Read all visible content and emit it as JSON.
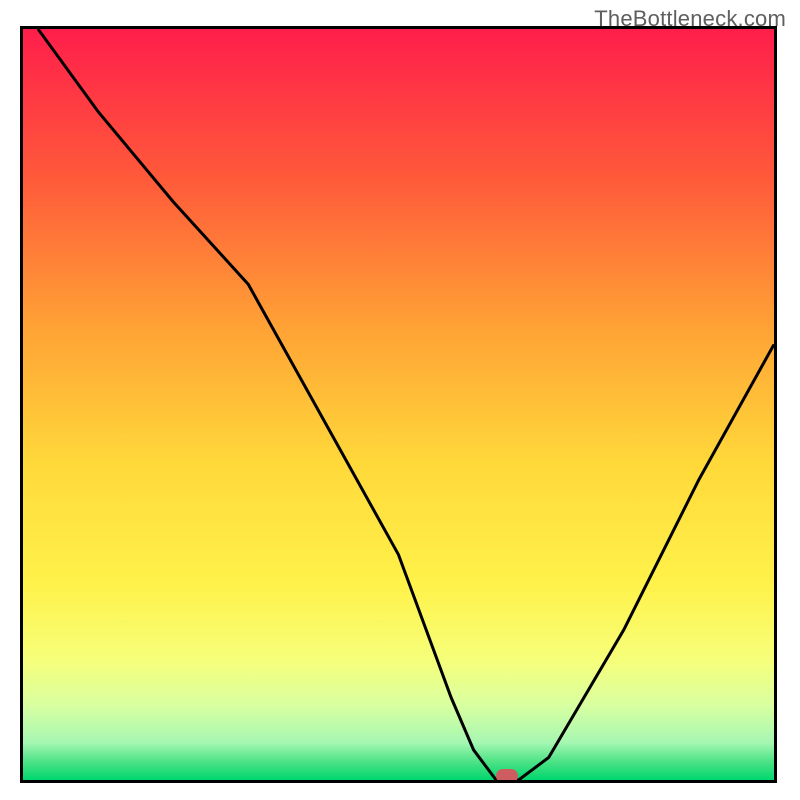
{
  "watermark": "TheBottleneck.com",
  "chart_data": {
    "type": "line",
    "title": "",
    "xlabel": "",
    "ylabel": "",
    "xlim": [
      0,
      100
    ],
    "ylim": [
      0,
      100
    ],
    "grid": false,
    "legend": false,
    "x": [
      2,
      10,
      20,
      30,
      40,
      50,
      57,
      60,
      63,
      66,
      70,
      80,
      90,
      100
    ],
    "y": [
      100,
      89,
      77,
      66,
      48,
      30,
      11,
      4,
      0,
      0,
      3,
      20,
      40,
      58
    ],
    "gradient_stops": [
      {
        "pos": 0.0,
        "color": "#ff1e4b"
      },
      {
        "pos": 0.2,
        "color": "#ff5a3a"
      },
      {
        "pos": 0.4,
        "color": "#ffa335"
      },
      {
        "pos": 0.58,
        "color": "#ffd93a"
      },
      {
        "pos": 0.74,
        "color": "#fff24a"
      },
      {
        "pos": 0.84,
        "color": "#f6ff7a"
      },
      {
        "pos": 0.9,
        "color": "#d9ffa0"
      },
      {
        "pos": 0.95,
        "color": "#a6f7b2"
      },
      {
        "pos": 0.975,
        "color": "#4fe387"
      },
      {
        "pos": 1.0,
        "color": "#00d66e"
      }
    ],
    "marker": {
      "x": 64.5,
      "y": 0,
      "color": "#cd5d60"
    }
  }
}
